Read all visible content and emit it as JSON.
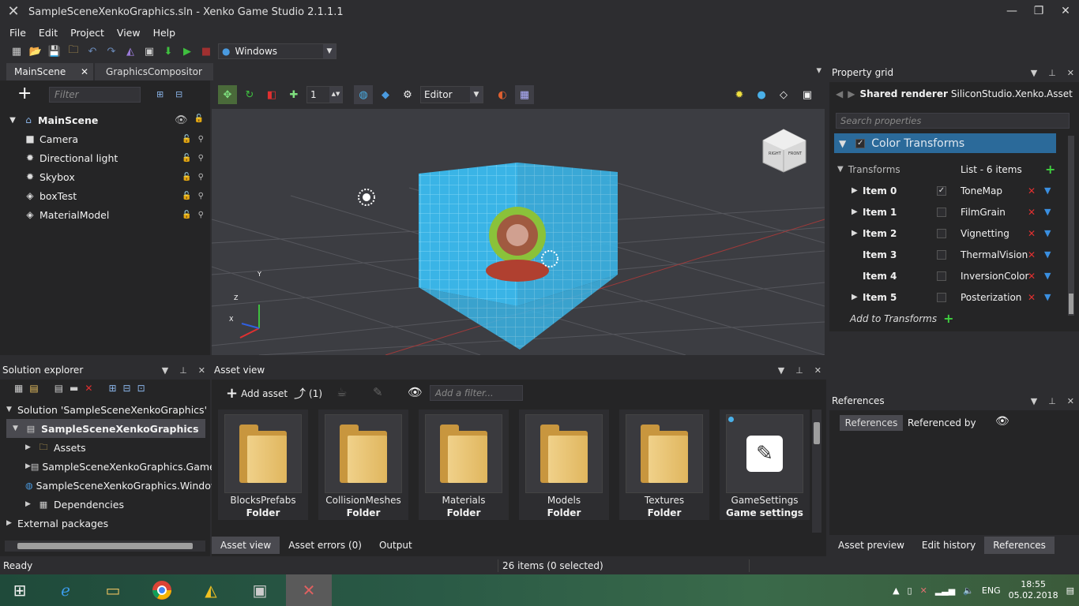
{
  "window": {
    "title": "SampleSceneXenkoGraphics.sln - Xenko Game Studio 2.1.1.1"
  },
  "menu": [
    "File",
    "Edit",
    "Project",
    "View",
    "Help"
  ],
  "toolbar": {
    "platform": "Windows"
  },
  "doc_tabs": [
    {
      "label": "MainScene",
      "active": true
    },
    {
      "label": "GraphicsCompositor",
      "active": false
    }
  ],
  "scene": {
    "filter_placeholder": "Filter",
    "root": "MainScene",
    "entities": [
      "Camera",
      "Directional light",
      "Skybox",
      "boxTest",
      "MaterialModel"
    ]
  },
  "viewport": {
    "snap_value": "1",
    "camera_mode": "Editor",
    "axes": {
      "y": "Y",
      "z": "Z",
      "x": "X"
    },
    "cube_faces": [
      "RIGHT",
      "FRONT"
    ]
  },
  "property_grid": {
    "title": "Property grid",
    "renderer_label": "Shared renderer",
    "renderer_type": "SiliconStudio.Xenko.Assets...",
    "search_placeholder": "Search properties",
    "section": "Color Transforms",
    "transforms_label": "Transforms",
    "transforms_count": "List - 6 items",
    "items": [
      {
        "name": "Item 0",
        "checked": true,
        "value": "ToneMap",
        "expandable": true
      },
      {
        "name": "Item 1",
        "checked": false,
        "value": "FilmGrain",
        "expandable": true
      },
      {
        "name": "Item 2",
        "checked": false,
        "value": "Vignetting",
        "expandable": true
      },
      {
        "name": "Item 3",
        "checked": false,
        "value": "ThermalVision",
        "expandable": false
      },
      {
        "name": "Item 4",
        "checked": false,
        "value": "InversionColor",
        "expandable": false
      },
      {
        "name": "Item 5",
        "checked": false,
        "value": "Posterization",
        "expandable": true
      }
    ],
    "add_label": "Add to Transforms"
  },
  "references": {
    "title": "References",
    "tab_references": "References",
    "tab_referenced_by": "Referenced by",
    "bottom_tabs": [
      "Asset preview",
      "Edit history",
      "References"
    ]
  },
  "solution_explorer": {
    "title": "Solution explorer",
    "rows": [
      {
        "label": "Solution 'SampleSceneXenkoGraphics'",
        "indent": 0,
        "expander": "▼"
      },
      {
        "label": "SampleSceneXenkoGraphics",
        "indent": 1,
        "expander": "▼",
        "selected": true
      },
      {
        "label": "Assets",
        "indent": 2,
        "expander": "▶"
      },
      {
        "label": "SampleSceneXenkoGraphics.Game",
        "indent": 2,
        "expander": "▶"
      },
      {
        "label": "SampleSceneXenkoGraphics.Windows",
        "indent": 2,
        "expander": ""
      },
      {
        "label": "Dependencies",
        "indent": 2,
        "expander": "▶"
      },
      {
        "label": "External packages",
        "indent": 0,
        "expander": "▶"
      }
    ]
  },
  "asset_view": {
    "title": "Asset view",
    "add_asset": "Add asset",
    "refs_count": "(1)",
    "filter_placeholder": "Add a filter...",
    "assets": [
      {
        "name": "BlocksPrefabs",
        "type": "Folder"
      },
      {
        "name": "CollisionMeshes",
        "type": "Folder"
      },
      {
        "name": "Materials",
        "type": "Folder"
      },
      {
        "name": "Models",
        "type": "Folder"
      },
      {
        "name": "Textures",
        "type": "Folder"
      },
      {
        "name": "GameSettings",
        "type": "Game settings"
      }
    ],
    "bottom_tabs": [
      "Asset view",
      "Asset errors (0)",
      "Output"
    ]
  },
  "status": {
    "left": "Ready",
    "middle": "26 items (0 selected)"
  },
  "taskbar": {
    "lang": "ENG",
    "time": "18:55",
    "date": "05.02.2018"
  },
  "colors": {
    "accent": "#007acc",
    "selected_tab": "#3e3e42",
    "section_bg": "#2b6a9a"
  }
}
